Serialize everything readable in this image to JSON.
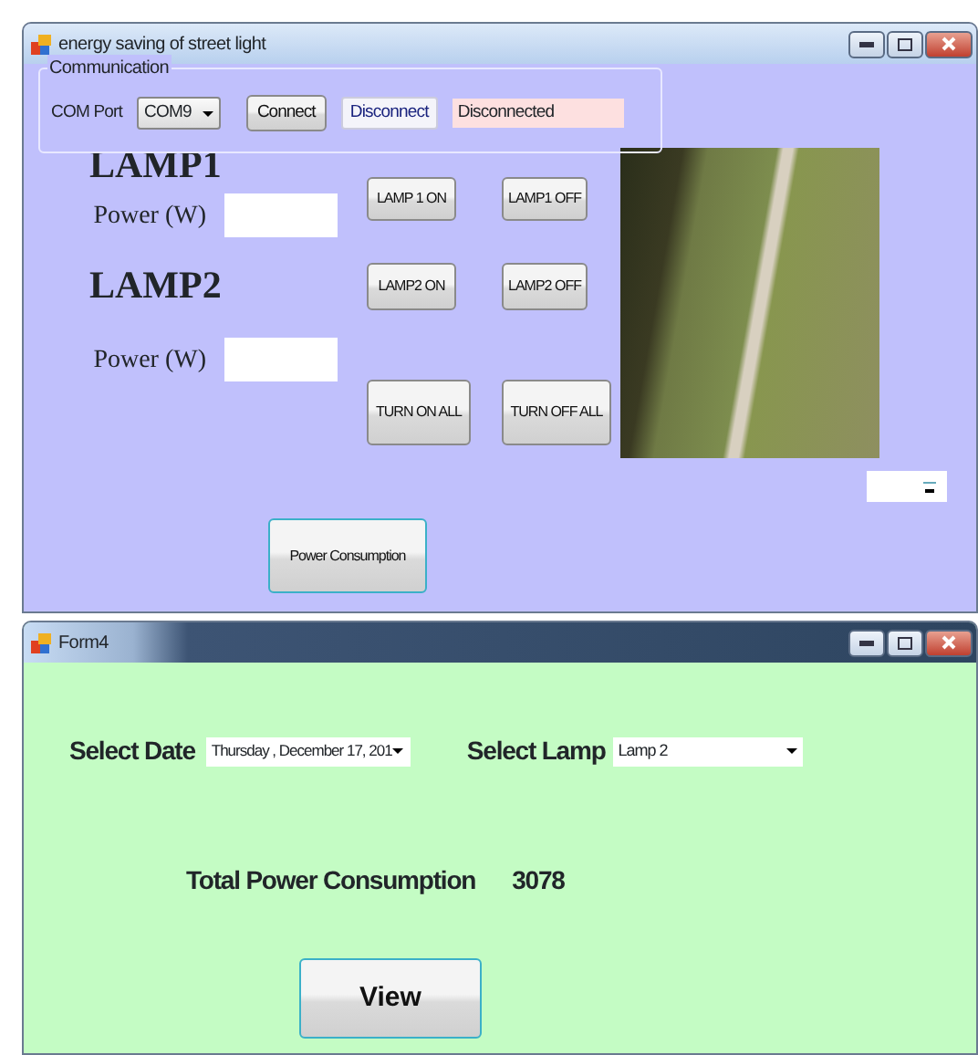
{
  "main_window": {
    "title": "energy saving of street light",
    "communication": {
      "title": "Communication",
      "port_label": "COM Port",
      "port_value": "COM9",
      "connect": "Connect",
      "disconnect": "Disconnect",
      "status": "Disconnected"
    },
    "lamps": [
      {
        "heading": "LAMP1",
        "power_label": "Power (W)"
      },
      {
        "heading": "LAMP2",
        "power_label": "Power (W)"
      }
    ],
    "lamp_buttons": [
      {
        "label": "LAMP 1 ON",
        "kind": "small"
      },
      {
        "label": "LAMP1 OFF",
        "kind": "small"
      },
      {
        "label": "LAMP2 ON",
        "kind": "small"
      },
      {
        "label": "LAMP2 OFF",
        "kind": "small"
      },
      {
        "label": "TURN ON ALL",
        "kind": "large"
      },
      {
        "label": "TURN OFF ALL",
        "kind": "large"
      }
    ],
    "power_consumption_button": "Power Consumption"
  },
  "form4": {
    "title": "Form4",
    "date_label": "Select Date",
    "date_value": "Thursday  , December 17, 201",
    "lamp_label": "Select Lamp",
    "lamp_value": "Lamp 2",
    "total_label": "Total Power Consumption",
    "total_value": "3078",
    "view_button": "View"
  }
}
